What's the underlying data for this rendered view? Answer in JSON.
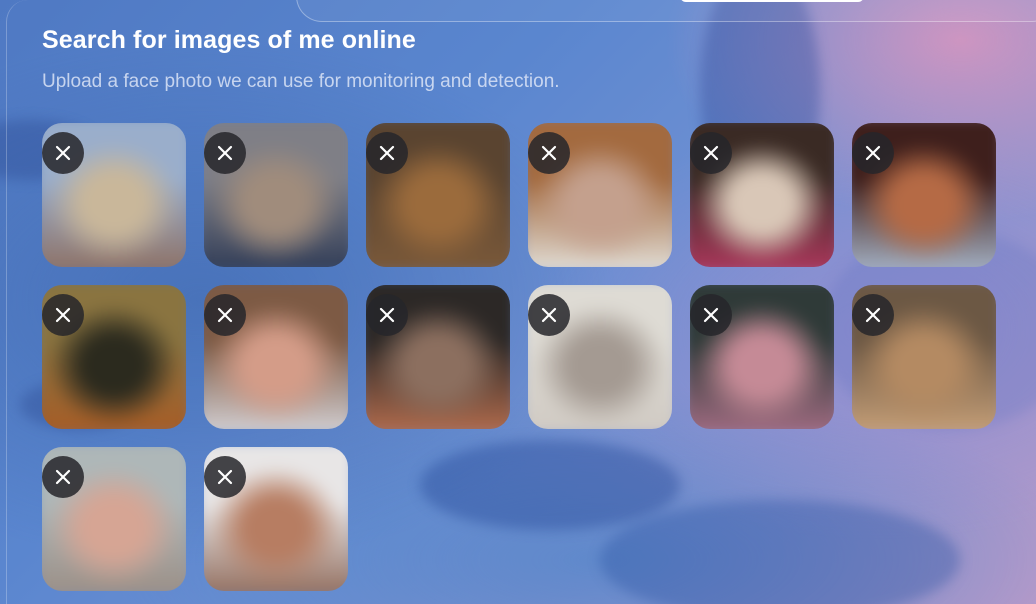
{
  "page": {
    "title": "Search for images of me online",
    "subtitle": "Upload a face photo we can use for monitoring and detection."
  },
  "photos": [
    {
      "label": "Uploaded face photo 1",
      "colors": [
        "#9aaecb",
        "#c9b79a",
        "#8d6f62"
      ]
    },
    {
      "label": "Uploaded face photo 2",
      "colors": [
        "#7f7f86",
        "#a08c7c",
        "#2e3a55"
      ]
    },
    {
      "label": "Uploaded face photo 3",
      "colors": [
        "#5a4430",
        "#9b6b3c",
        "#7c5a3a"
      ]
    },
    {
      "label": "Uploaded face photo 4",
      "colors": [
        "#a36a3f",
        "#c4a08d",
        "#e4e2dc"
      ]
    },
    {
      "label": "Uploaded face photo 5",
      "colors": [
        "#3a2a24",
        "#d9c7b7",
        "#b0385e"
      ]
    },
    {
      "label": "Uploaded face photo 6",
      "colors": [
        "#3e1f1c",
        "#b56a45",
        "#a8b6c9"
      ]
    },
    {
      "label": "Uploaded face photo 7",
      "colors": [
        "#8a7440",
        "#2b2a1e",
        "#a85b25"
      ]
    },
    {
      "label": "Uploaded face photo 8",
      "colors": [
        "#7d5a44",
        "#d49c88",
        "#d6d4d8"
      ]
    },
    {
      "label": "Uploaded face photo 9",
      "colors": [
        "#2c2826",
        "#8c6f5f",
        "#b86f4f"
      ]
    },
    {
      "label": "Uploaded face photo 10",
      "colors": [
        "#dedbd4",
        "#a49a92",
        "#cfc9c2"
      ]
    },
    {
      "label": "Uploaded face photo 11",
      "colors": [
        "#2f3a38",
        "#c58a96",
        "#a46d84"
      ]
    },
    {
      "label": "Uploaded face photo 12",
      "colors": [
        "#6c5844",
        "#b48a62",
        "#c9a27a"
      ]
    },
    {
      "label": "Uploaded face photo 13",
      "colors": [
        "#aeb7b8",
        "#d6a594",
        "#9a8d84"
      ]
    },
    {
      "label": "Uploaded face photo 14",
      "colors": [
        "#e8e6e6",
        "#b77d62",
        "#8f6a5a"
      ]
    }
  ],
  "icons": {
    "remove": "close-icon"
  },
  "colors": {
    "text_primary": "#ffffff",
    "remove_button_bg": "#26262a"
  }
}
